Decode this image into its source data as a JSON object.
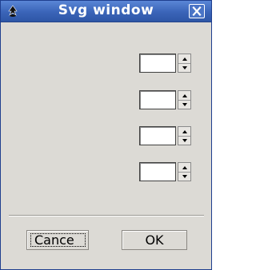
{
  "window": {
    "title": "Svg window",
    "titlebar_color": "#3a64b8",
    "background": "#dcdad5",
    "app_icon": "inkscape-icon",
    "close_icon": "close-icon"
  },
  "spinboxes": [
    {
      "value": ""
    },
    {
      "value": ""
    },
    {
      "value": ""
    },
    {
      "value": ""
    }
  ],
  "buttons": {
    "cancel_label": "Cance",
    "ok_label": "OK"
  }
}
